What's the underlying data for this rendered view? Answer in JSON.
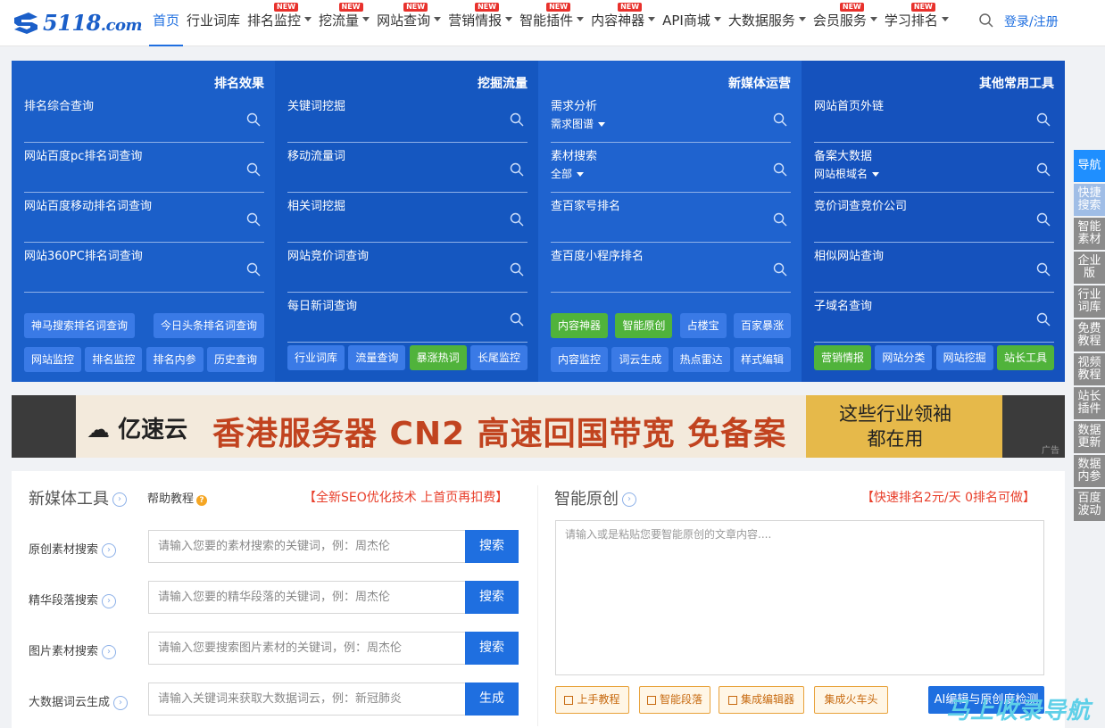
{
  "header": {
    "logo_text": "5118",
    "logo_suffix": ".com",
    "nav": [
      {
        "label": "首页",
        "active": true,
        "caret": false,
        "new": false
      },
      {
        "label": "行业词库",
        "active": false,
        "caret": false,
        "new": false
      },
      {
        "label": "排名监控",
        "active": false,
        "caret": true,
        "new": true
      },
      {
        "label": "挖流量",
        "active": false,
        "caret": true,
        "new": true
      },
      {
        "label": "网站查询",
        "active": false,
        "caret": true,
        "new": true
      },
      {
        "label": "营销情报",
        "active": false,
        "caret": true,
        "new": true
      },
      {
        "label": "智能插件",
        "active": false,
        "caret": true,
        "new": true
      },
      {
        "label": "内容神器",
        "active": false,
        "caret": true,
        "new": true
      },
      {
        "label": "API商城",
        "active": false,
        "caret": true,
        "new": false
      },
      {
        "label": "大数据服务",
        "active": false,
        "caret": true,
        "new": false
      },
      {
        "label": "会员服务",
        "active": false,
        "caret": true,
        "new": true
      },
      {
        "label": "学习排名",
        "active": false,
        "caret": true,
        "new": true
      }
    ],
    "new_badge": "NEW",
    "login": "登录/注册"
  },
  "panel": {
    "columns": [
      {
        "title": "排名效果",
        "fields": [
          {
            "label": "排名综合查询",
            "sub": ""
          },
          {
            "label": "网站百度pc排名词查询",
            "sub": ""
          },
          {
            "label": "网站百度移动排名词查询",
            "sub": ""
          },
          {
            "label": "网站360PC排名词查询",
            "sub": ""
          }
        ],
        "buttons_row1": [
          {
            "label": "神马搜索排名词查询",
            "green": false
          },
          {
            "label": "今日头条排名词查询",
            "green": false
          }
        ],
        "buttons_row2": [
          {
            "label": "网站监控",
            "green": false
          },
          {
            "label": "排名监控",
            "green": false
          },
          {
            "label": "排名内参",
            "green": false
          },
          {
            "label": "历史查询",
            "green": false
          }
        ]
      },
      {
        "title": "挖掘流量",
        "fields": [
          {
            "label": "关键词挖掘",
            "sub": ""
          },
          {
            "label": "移动流量词",
            "sub": ""
          },
          {
            "label": "相关词挖掘",
            "sub": ""
          },
          {
            "label": "网站竞价词查询",
            "sub": ""
          },
          {
            "label": "每日新词查询",
            "sub": ""
          }
        ],
        "buttons_row1": [],
        "buttons_row2": [
          {
            "label": "行业词库",
            "green": false
          },
          {
            "label": "流量查询",
            "green": false
          },
          {
            "label": "暴涨热词",
            "green": true
          },
          {
            "label": "长尾监控",
            "green": false
          }
        ]
      },
      {
        "title": "新媒体运营",
        "fields": [
          {
            "label": "需求分析",
            "sub": "需求图谱"
          },
          {
            "label": "素材搜索",
            "sub": "全部"
          },
          {
            "label": "查百家号排名",
            "sub": ""
          },
          {
            "label": "查百度小程序排名",
            "sub": ""
          }
        ],
        "buttons_row1": [
          {
            "label": "内容神器",
            "green": true
          },
          {
            "label": "智能原创",
            "green": true
          },
          {
            "label": "占楼宝",
            "green": false
          },
          {
            "label": "百家暴涨",
            "green": false
          }
        ],
        "buttons_row2": [
          {
            "label": "内容监控",
            "green": false
          },
          {
            "label": "词云生成",
            "green": false
          },
          {
            "label": "热点雷达",
            "green": false
          },
          {
            "label": "样式编辑",
            "green": false
          }
        ]
      },
      {
        "title": "其他常用工具",
        "fields": [
          {
            "label": "网站首页外链",
            "sub": ""
          },
          {
            "label": "备案大数据",
            "sub": "网站根域名"
          },
          {
            "label": "竞价词查竞价公司",
            "sub": ""
          },
          {
            "label": "相似网站查询",
            "sub": ""
          },
          {
            "label": "子域名查询",
            "sub": ""
          }
        ],
        "buttons_row1": [],
        "buttons_row2": [
          {
            "label": "营销情报",
            "green": true
          },
          {
            "label": "网站分类",
            "green": false
          },
          {
            "label": "网站挖掘",
            "green": false
          },
          {
            "label": "站长工具",
            "green": true
          }
        ]
      }
    ]
  },
  "ad": {
    "brand": "亿速云",
    "headline": "香港服务器 CN2 高速回国带宽 免备案",
    "right_line1": "这些行业领袖",
    "right_line2": "都在用",
    "tag": "广告"
  },
  "media_tools": {
    "title": "新媒体工具",
    "help": "帮助教程",
    "promo": "【全新SEO优化技术 上首页再扣费】",
    "rows": [
      {
        "label": "原创素材搜索",
        "placeholder": "请输入您要的素材搜索的关键词，例：周杰伦",
        "button": "搜索"
      },
      {
        "label": "精华段落搜索",
        "placeholder": "请输入您要的精华段落的关键词，例：周杰伦",
        "button": "搜索"
      },
      {
        "label": "图片素材搜索",
        "placeholder": "请输入您要搜索图片素材的关键词，例：周杰伦",
        "button": "搜索"
      },
      {
        "label": "大数据词云生成",
        "placeholder": "请输入关键词来获取大数据词云，例：新冠肺炎",
        "button": "生成"
      }
    ]
  },
  "smart_original": {
    "title": "智能原创",
    "promo": "【快速排名2元/天 0排名可做】",
    "textarea_placeholder": "请输入或是粘贴您要智能原创的文章内容....",
    "buttons": [
      "上手教程",
      "智能段落",
      "集成编辑器",
      "集成火车头"
    ],
    "primary_button": "AI编辑与原创度检测"
  },
  "watermark": "马上收录导航",
  "side_nav": [
    "导航",
    "快捷搜索",
    "智能素材",
    "企业版",
    "行业词库",
    "免费教程",
    "视频教程",
    "站长插件",
    "数据更新",
    "数据内参",
    "百度波动"
  ]
}
